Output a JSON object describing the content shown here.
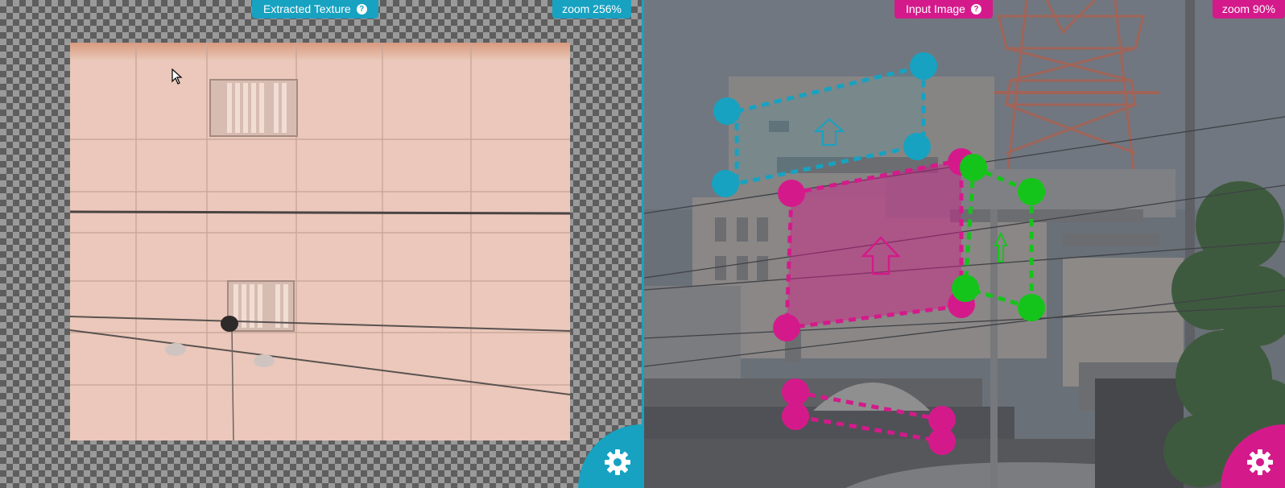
{
  "left_panel": {
    "title": "Extracted Texture",
    "zoom": "zoom 256%",
    "help_icon": "help-icon",
    "settings_icon": "gear-icon",
    "accent": "#17a2c1"
  },
  "right_panel": {
    "title": "Input Image",
    "zoom": "zoom 90%",
    "help_icon": "help-icon",
    "settings_icon": "gear-icon",
    "accent": "#d41a8b"
  },
  "quad_colors": {
    "cyan": "#17a2c1",
    "magenta": "#d41a8b",
    "green": "#15c41a"
  },
  "cursor_icon": "arrow-cursor-icon"
}
